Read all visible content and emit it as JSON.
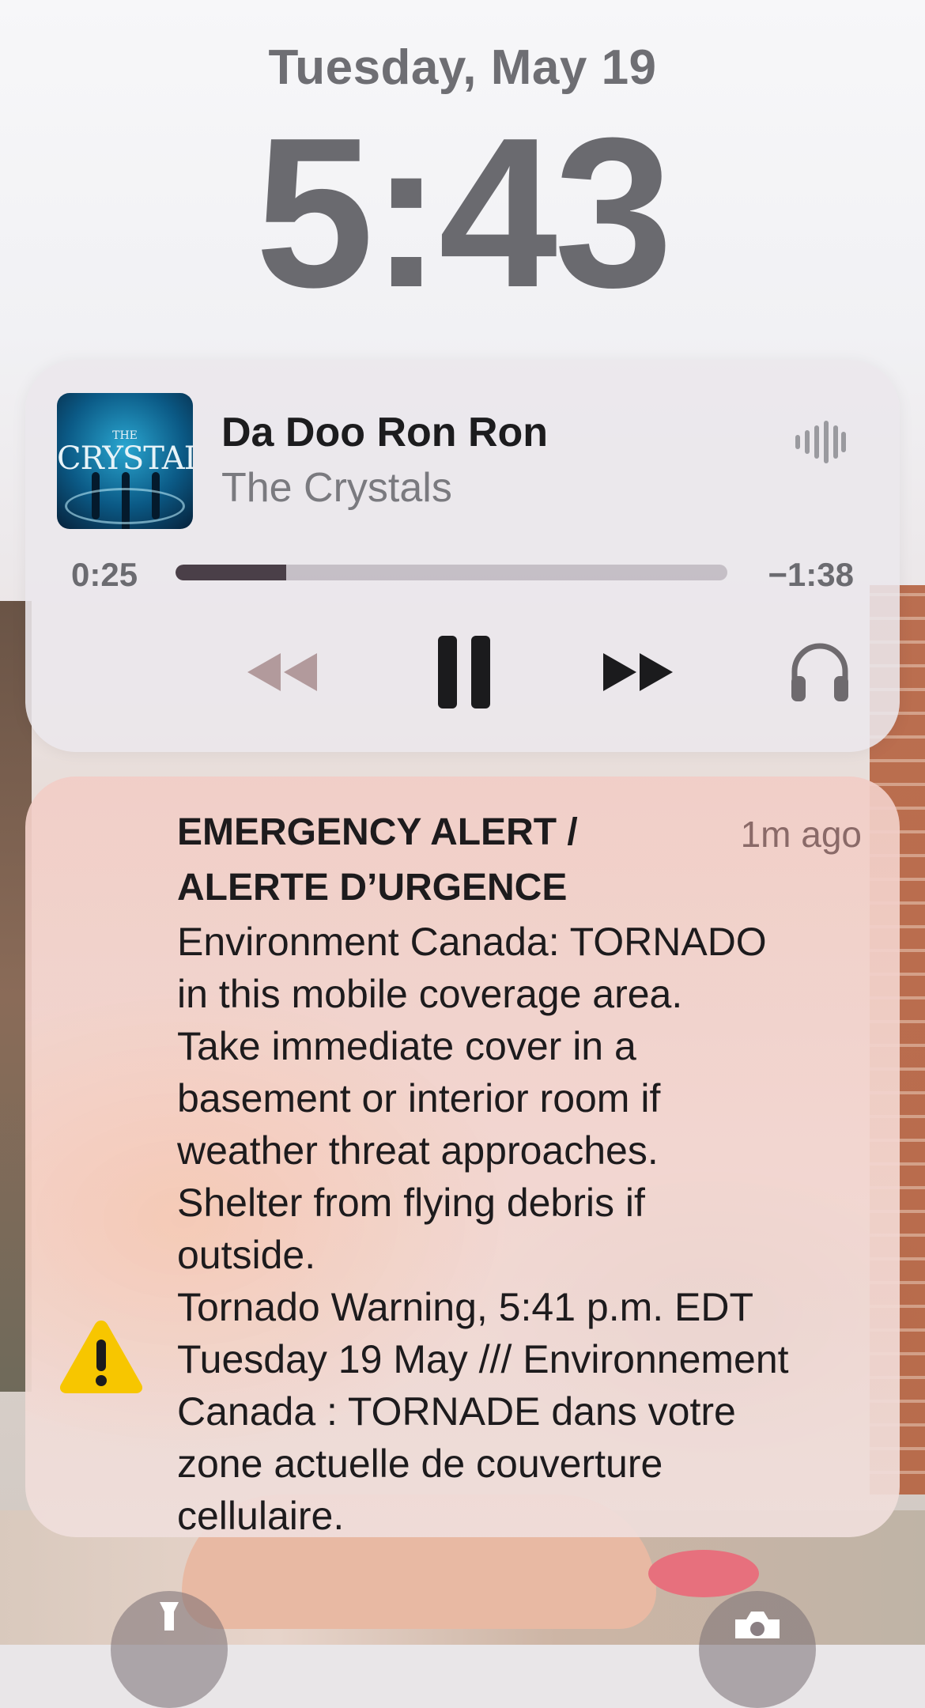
{
  "lockscreen": {
    "date": "Tuesday, May 19",
    "time": "5:43"
  },
  "now_playing": {
    "album_art_text": "CRYSTALS",
    "album_art_small_text": "THE",
    "song_title": "Da Doo Ron Ron",
    "artist": "The Crystals",
    "elapsed": "0:25",
    "remaining": "−1:38",
    "progress_fraction": 0.2,
    "controls": {
      "rewind_icon": "rewind-icon",
      "pause_icon": "pause-icon",
      "forward_icon": "fast-forward-icon",
      "output_icon": "headphones-icon"
    }
  },
  "notification": {
    "title": "EMERGENCY ALERT / ALERTE D’URGENCE",
    "time_ago": "1m ago",
    "body": "Environment Canada: TORNADO\nin this mobile coverage area.\nTake immediate cover in a\nbasement or interior room if\nweather threat approaches.\nShelter from flying debris if\noutside.\nTornado Warning, 5:41 p.m. EDT\nTuesday 19 May /// Environnement\nCanada : TORNADE dans votre\nzone actuelle de couverture\ncellulaire.",
    "icon": "warning-triangle-icon",
    "icon_color": "#f7c600"
  },
  "quick_actions": {
    "left_icon": "flashlight-icon",
    "right_icon": "camera-icon"
  }
}
